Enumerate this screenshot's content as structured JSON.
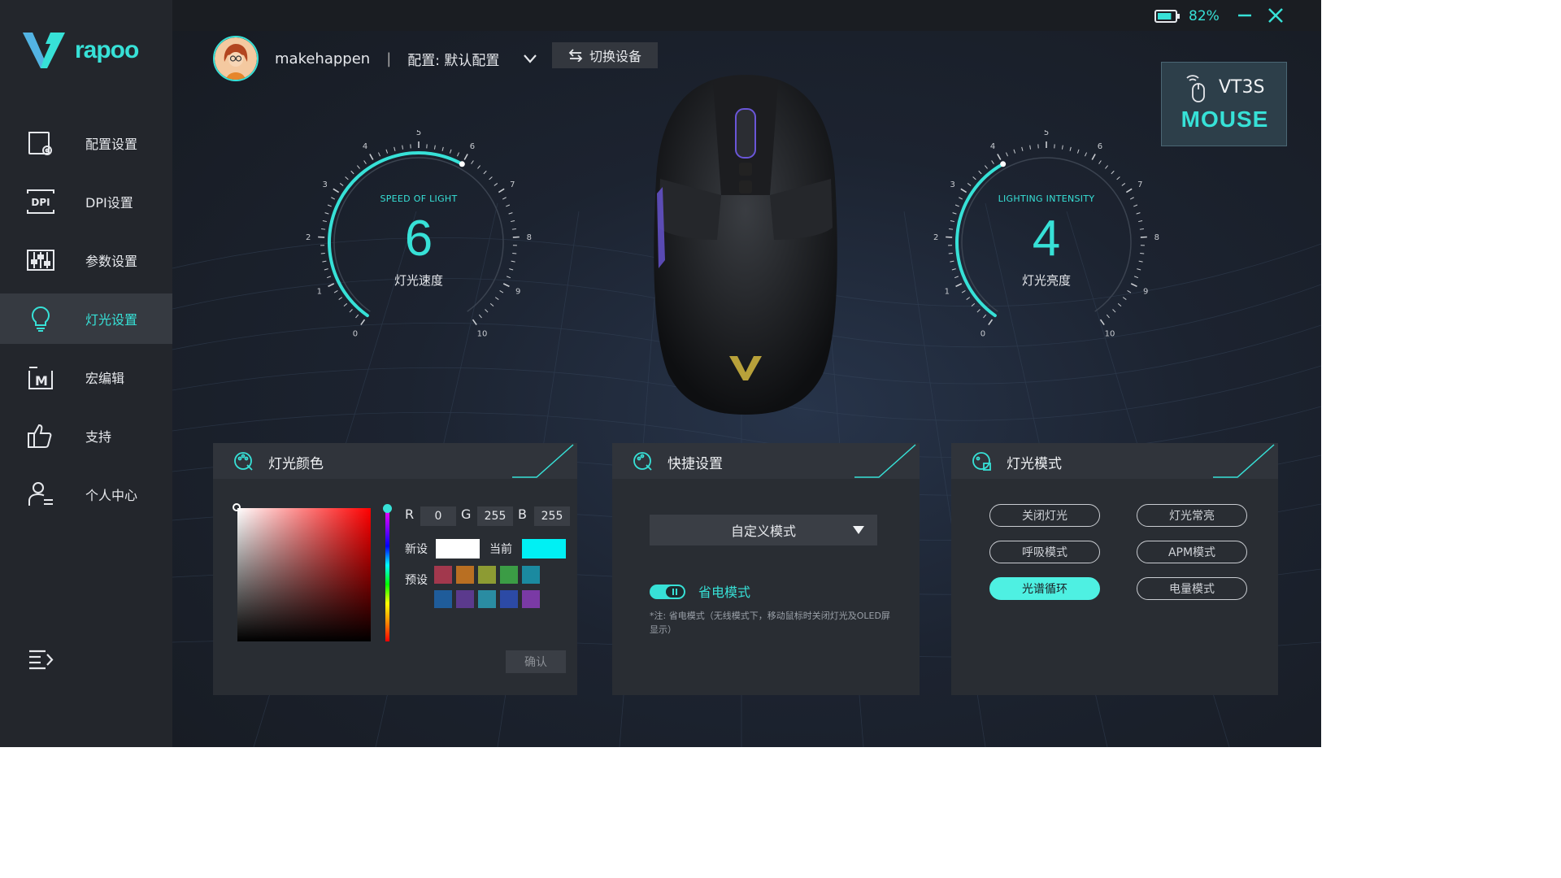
{
  "brand": {
    "name": "rapoo",
    "accent": "#37e1d7"
  },
  "sidebar": {
    "items": [
      {
        "label": "配置设置",
        "icon": "profile-settings-icon",
        "active": false
      },
      {
        "label": "DPI设置",
        "icon": "dpi-icon",
        "active": false
      },
      {
        "label": "参数设置",
        "icon": "sliders-icon",
        "active": false
      },
      {
        "label": "灯光设置",
        "icon": "lightbulb-icon",
        "active": true
      },
      {
        "label": "宏编辑",
        "icon": "macro-icon",
        "active": false
      },
      {
        "label": "支持",
        "icon": "thumbs-up-icon",
        "active": false
      },
      {
        "label": "个人中心",
        "icon": "user-center-icon",
        "active": false
      }
    ]
  },
  "topbar": {
    "battery": "82%",
    "battery_level": 0.82
  },
  "user": {
    "name": "makehappen",
    "separator": "|",
    "config": "配置: 默认配置"
  },
  "switch_device": {
    "label": "切换设备"
  },
  "device": {
    "name": "VT3S",
    "type": "MOUSE"
  },
  "speed_gauge": {
    "caption": "SPEED OF LIGHT",
    "value": "6",
    "label": "灯光速度",
    "min": 0,
    "max": 10,
    "ticks": [
      "0",
      "1",
      "2",
      "3",
      "4",
      "5",
      "6",
      "7",
      "8",
      "9",
      "10"
    ]
  },
  "intensity_gauge": {
    "caption": "LIGHTING INTENSITY",
    "value": "4",
    "label": "灯光亮度",
    "min": 0,
    "max": 10,
    "ticks": [
      "0",
      "1",
      "2",
      "3",
      "4",
      "5",
      "6",
      "7",
      "8",
      "9",
      "10"
    ]
  },
  "color_panel": {
    "title": "灯光颜色",
    "r_label": "R",
    "r": "0",
    "g_label": "G",
    "g": "255",
    "b_label": "B",
    "b": "255",
    "new_label": "新设",
    "new_color": "#ffffff",
    "current_label": "当前",
    "current_color": "#00f0f4",
    "preset_label": "预设",
    "presets": [
      "#a2384d",
      "#b96f22",
      "#8d9b33",
      "#3b9c45",
      "#1b8aa0",
      "#1f5c9a",
      "#5b3a8d",
      "#2a8ca2",
      "#2c4aa5",
      "#7a3aa5"
    ],
    "confirm": "确认"
  },
  "quick_panel": {
    "title": "快捷设置",
    "mode": "自定义模式",
    "eco_label": "省电模式",
    "eco_on": true,
    "eco_note": "*注: 省电模式（无线模式下，移动鼠标时关闭灯光及OLED屏显示）"
  },
  "light_mode_panel": {
    "title": "灯光模式",
    "modes": [
      {
        "label": "关闭灯光",
        "active": false
      },
      {
        "label": "灯光常亮",
        "active": false
      },
      {
        "label": "呼吸模式",
        "active": false
      },
      {
        "label": "APM模式",
        "active": false
      },
      {
        "label": "光谱循环",
        "active": true
      },
      {
        "label": "电量模式",
        "active": false
      }
    ]
  }
}
